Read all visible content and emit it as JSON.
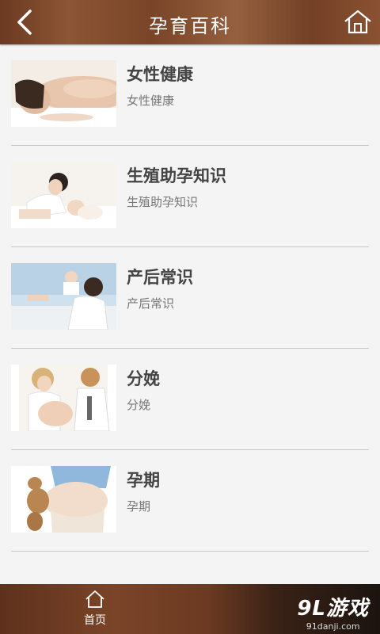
{
  "header": {
    "title": "孕育百科",
    "back_icon": "chevron-left-icon",
    "home_icon": "home-icon"
  },
  "items": [
    {
      "title": "女性健康",
      "subtitle": "女性健康"
    },
    {
      "title": "生殖助孕知识",
      "subtitle": "生殖助孕知识"
    },
    {
      "title": "产后常识",
      "subtitle": "产后常识"
    },
    {
      "title": "分娩",
      "subtitle": "分娩"
    },
    {
      "title": "孕期",
      "subtitle": "孕期"
    }
  ],
  "bottom_nav": {
    "home_label": "首页",
    "home_icon": "home-icon"
  },
  "watermark": {
    "brand": "9L游戏",
    "site": "91danji.com"
  },
  "colors": {
    "bar_brown": "#7a4428",
    "background": "#f4f4f4",
    "title_text": "#444444",
    "subtitle_text": "#777777"
  }
}
